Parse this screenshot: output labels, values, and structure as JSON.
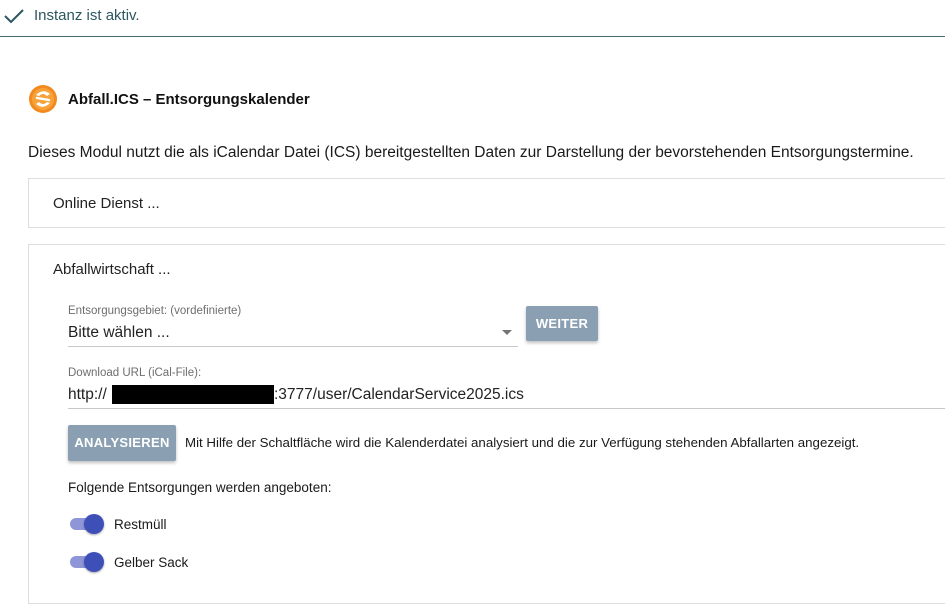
{
  "status": {
    "text": "Instanz ist aktiv.",
    "icon": "check-icon"
  },
  "header": {
    "title": "Abfall.ICS – Entsorgungskalender",
    "logo_icon": "abfall-logo-icon"
  },
  "description": "Dieses Modul nutzt die als iCalendar Datei (ICS) bereitgestellten Daten zur Darstellung der bevorstehenden Entsorgungstermine.",
  "panels": {
    "online": {
      "title": "Online Dienst ..."
    },
    "abfall": {
      "title": "Abfallwirtschaft ...",
      "area": {
        "label": "Entsorgungsgebiet: (vordefinierte)",
        "value": "Bitte wählen ...",
        "button": "WEITER"
      },
      "url": {
        "label": "Download URL (iCal-File):",
        "prefix": "http://",
        "suffix": ":3777/user/CalendarService2025.ics"
      },
      "analyze": {
        "button": "ANALYSIEREN",
        "help": "Mit Hilfe der Schaltfläche wird die Kalenderdatei analysiert und die zur Verfügung stehenden Abfallarten angezeigt."
      },
      "offered_label": "Folgende Entsorgungen werden angeboten:",
      "toggles": [
        {
          "label": "Restmüll",
          "on": true
        },
        {
          "label": "Gelber Sack",
          "on": true
        }
      ]
    }
  },
  "colors": {
    "accent": "#3f4fb8",
    "button": "#8aa0b2",
    "status_text": "#2b5660"
  }
}
